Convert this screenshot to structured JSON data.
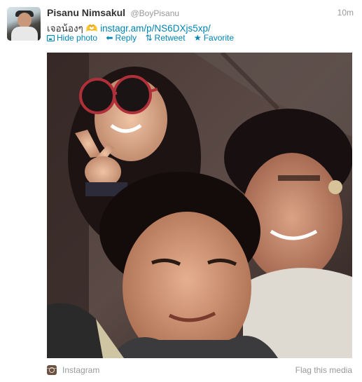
{
  "tweet": {
    "author_name": "Pisanu Nimsakul",
    "author_handle": "@BoyPisanu",
    "timestamp": "10m",
    "text_prefix": "เจอน้องๆ ",
    "text_symbol": "🫶",
    "text_link": "instagr.am/p/NS6DXjs5xp/"
  },
  "actions": {
    "hide_photo": "Hide photo",
    "reply": "Reply",
    "retweet": "Retweet",
    "favorite": "Favorite"
  },
  "media": {
    "source_label": "Instagram",
    "flag_label": "Flag this media"
  },
  "colors": {
    "link": "#0084b4",
    "muted": "#999999",
    "text": "#333333"
  }
}
